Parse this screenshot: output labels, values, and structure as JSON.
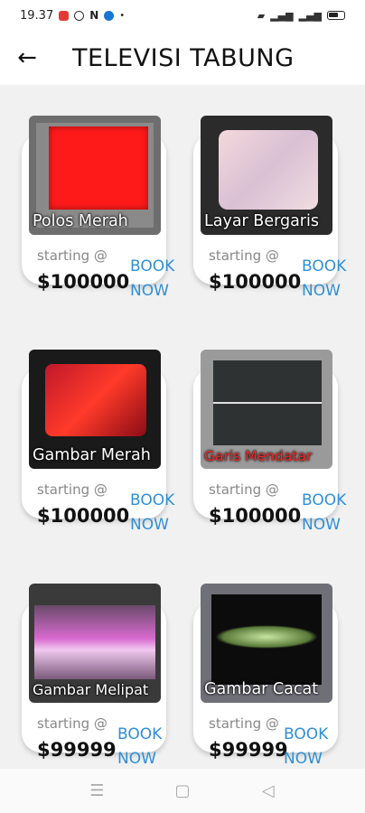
{
  "status": {
    "time": "19.37",
    "icons": [
      "notification-red-icon",
      "location-icon",
      "netflix-icon",
      "app-icon",
      "dot-icon"
    ],
    "right_icons": [
      "wifi-icon",
      "signal-icon",
      "signal-icon",
      "signal-icon",
      "battery-icon"
    ]
  },
  "header": {
    "back_icon": "arrow-left-icon",
    "title": "TELEVISI TABUNG"
  },
  "accent_color": "#2f8fd6",
  "products": [
    {
      "label": "Polos Merah",
      "starting": "starting @",
      "price": "$100000",
      "book1": "BOOK",
      "book2": "NOW"
    },
    {
      "label": "Layar Bergaris",
      "starting": "starting @",
      "price": "$100000",
      "book1": "BOOK",
      "book2": "NOW"
    },
    {
      "label": "Gambar Merah",
      "starting": "starting @",
      "price": "$100000",
      "book1": "BOOK",
      "book2": "NOW"
    },
    {
      "label": "Garis Mendatar",
      "starting": "starting @",
      "price": "$100000",
      "book1": "BOOK",
      "book2": "NOW"
    },
    {
      "label": "Gambar Melipat",
      "starting": "starting @",
      "price": "$99999",
      "book1": "BOOK",
      "book2": "NOW"
    },
    {
      "label": "Gambar Cacat",
      "starting": "starting @",
      "price": "$99999",
      "book1": "BOOK",
      "book2": "NOW"
    }
  ],
  "navbar": {
    "icons": [
      "menu-icon",
      "home-square-icon",
      "back-triangle-icon"
    ]
  }
}
